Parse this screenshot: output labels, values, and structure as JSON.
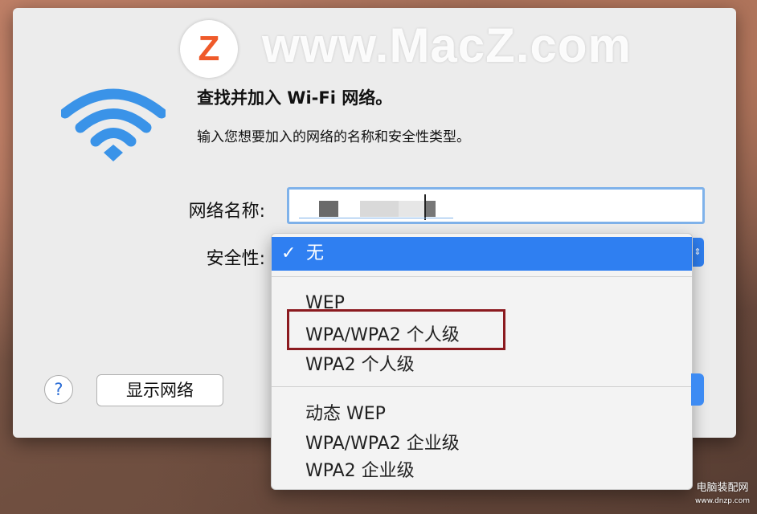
{
  "watermark": {
    "logo_letter": "Z",
    "site": "www.MacZ.com",
    "corner_line1": "电脑装配网",
    "corner_line2": "www.dnzp.com"
  },
  "dialog": {
    "title": "查找并加入 Wi-Fi 网络。",
    "subtitle": "输入您想要加入的网络的名称和安全性类型。",
    "icon": "wifi-icon",
    "network_name_label": "网络名称:",
    "security_label": "安全性:",
    "help_label": "?",
    "show_networks_label": "显示网络"
  },
  "security_menu": {
    "selected": "无",
    "options_group1": [
      "WEP",
      "WPA/WPA2 个人级",
      "WPA2 个人级"
    ],
    "options_group2": [
      "动态 WEP",
      "WPA/WPA2 企业级",
      "WPA2 企业级"
    ],
    "highlighted_option": "WPA/WPA2 个人级"
  },
  "colors": {
    "accent": "#2f7ff1",
    "highlight_border": "#8b1a1f",
    "wifi": "#3a93e8"
  }
}
